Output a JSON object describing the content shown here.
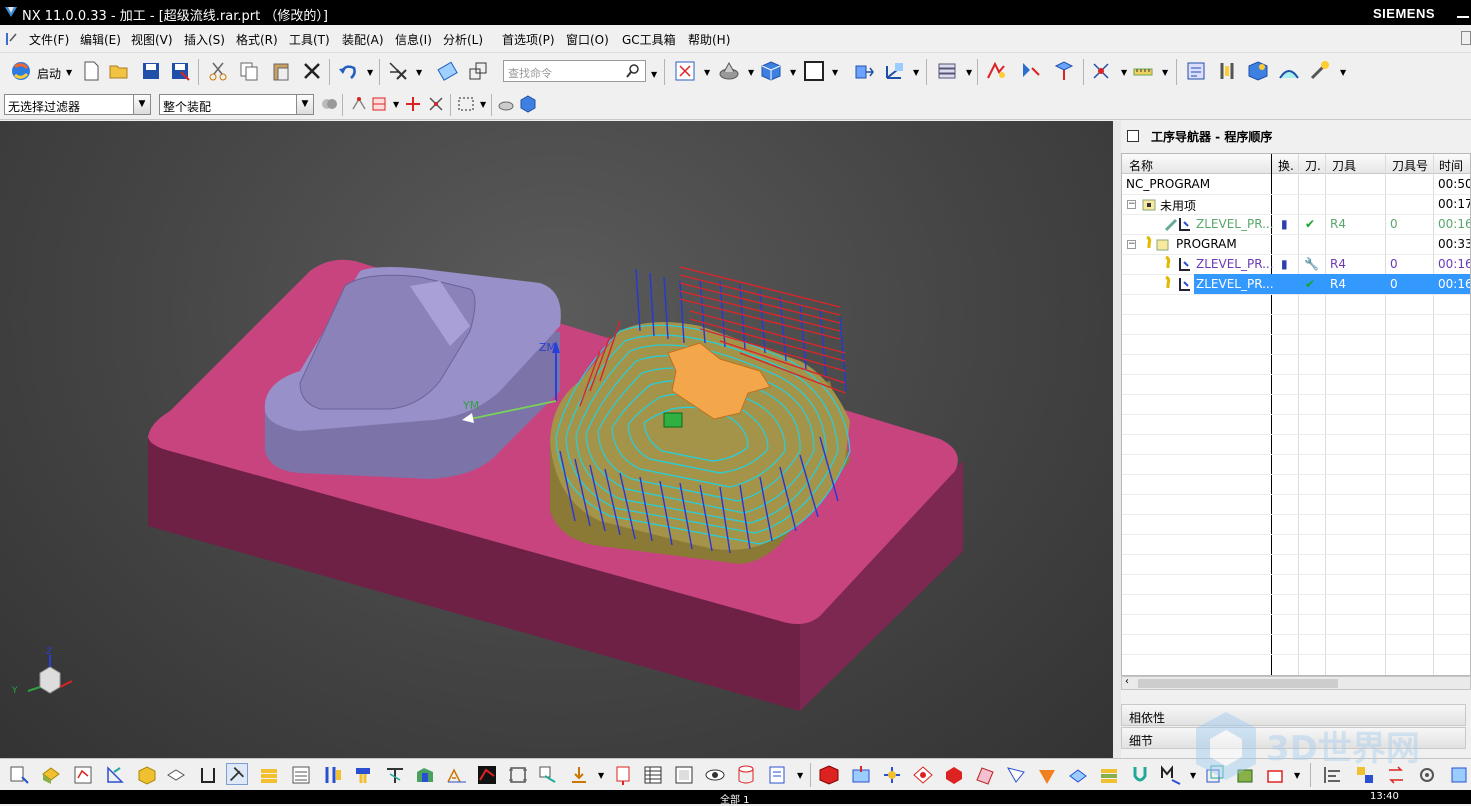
{
  "title": {
    "text": "NX 11.0.0.33 - 加工 - [超级流线.rar.prt （修改的）]",
    "brand": "SIEMENS"
  },
  "menu": [
    "文件(F)",
    "编辑(E)",
    "视图(V)",
    "插入(S)",
    "格式(R)",
    "工具(T)",
    "装配(A)",
    "信息(I)",
    "分析(L)",
    "首选项(P)",
    "窗口(O)",
    "GC工具箱",
    "帮助(H)"
  ],
  "toolbar": {
    "start_label": "启动",
    "search_placeholder": "查找命令"
  },
  "filters": {
    "selection_filter": "无选择过滤器",
    "assembly_scope": "整个装配"
  },
  "viewport": {
    "axis_zm": "ZM",
    "axis_ym": "YM",
    "triad_y": "Y",
    "triad_z": "Z"
  },
  "navigator": {
    "title": "工序导航器 - 程序顺序",
    "columns": [
      "名称",
      "换.",
      "刀.",
      "刀具",
      "刀具号",
      "时间"
    ],
    "rows": [
      {
        "name": "NC_PROGRAM",
        "change": "",
        "path": "",
        "tool": "",
        "tool_no": "",
        "time": "00:50:",
        "style": "normal"
      },
      {
        "name": "未用项",
        "change": "",
        "path": "",
        "tool": "",
        "tool_no": "",
        "time": "00:17:",
        "style": "normal"
      },
      {
        "name": "ZLEVEL_PR...",
        "change": "▮",
        "path": "✔",
        "tool": "R4",
        "tool_no": "0",
        "time": "00:16:",
        "style": "green"
      },
      {
        "name": "PROGRAM",
        "change": "",
        "path": "",
        "tool": "",
        "tool_no": "",
        "time": "00:33:",
        "style": "normal"
      },
      {
        "name": "ZLEVEL_PR...",
        "change": "▮",
        "path": "🔧",
        "tool": "R4",
        "tool_no": "0",
        "time": "00:16:",
        "style": "purple"
      },
      {
        "name": "ZLEVEL_PR...",
        "change": "",
        "path": "✔",
        "tool": "R4",
        "tool_no": "0",
        "time": "00:16:",
        "style": "selected"
      }
    ],
    "sections": [
      "相依性",
      "细节"
    ]
  },
  "status": {
    "center": "全部 1",
    "right": "13:40"
  },
  "watermark": "3D世界网"
}
